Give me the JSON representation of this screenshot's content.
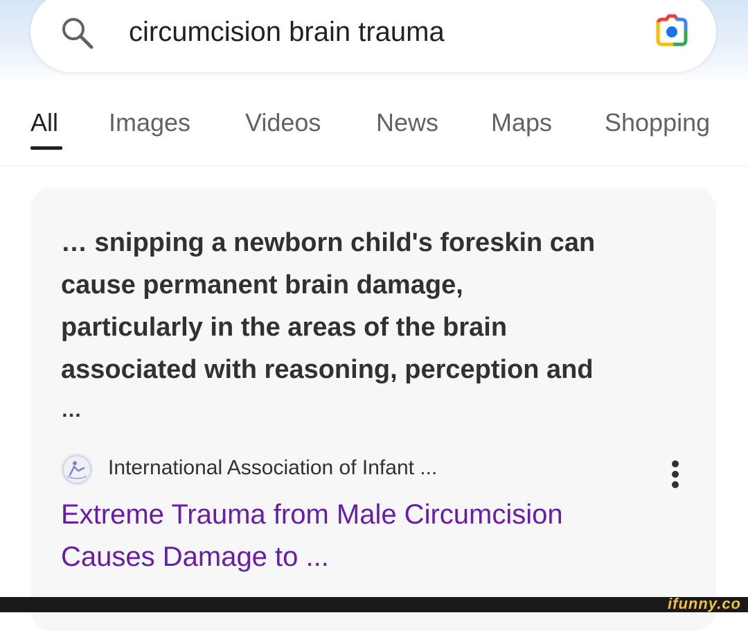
{
  "search": {
    "query": "circumcision brain trauma",
    "search_icon": "search-icon",
    "lens_icon": "google-lens-camera-icon"
  },
  "tabs": [
    {
      "label": "All",
      "active": true
    },
    {
      "label": "Images",
      "active": false
    },
    {
      "label": "Videos",
      "active": false
    },
    {
      "label": "News",
      "active": false
    },
    {
      "label": "Maps",
      "active": false
    },
    {
      "label": "Shopping",
      "active": false
    }
  ],
  "result": {
    "snippet_lines": [
      "… snipping a newborn child's foreskin can",
      "cause permanent brain damage,",
      "particularly in the areas of the brain",
      "associated with reasoning, perception and"
    ],
    "snippet_trailing": "…",
    "source": "International Association of Infant ...",
    "title_lines": [
      "Extreme Trauma from Male Circumcision",
      "Causes Damage to ..."
    ],
    "title_color": "#681da8",
    "favicon_icon": "infant-figure-icon",
    "more_icon": "more-vertical-icon"
  },
  "watermark": "ifunny.co",
  "colors": {
    "active_tab": "#202124",
    "inactive_tab": "#5f6368",
    "card_background": "#f7f7f8"
  }
}
